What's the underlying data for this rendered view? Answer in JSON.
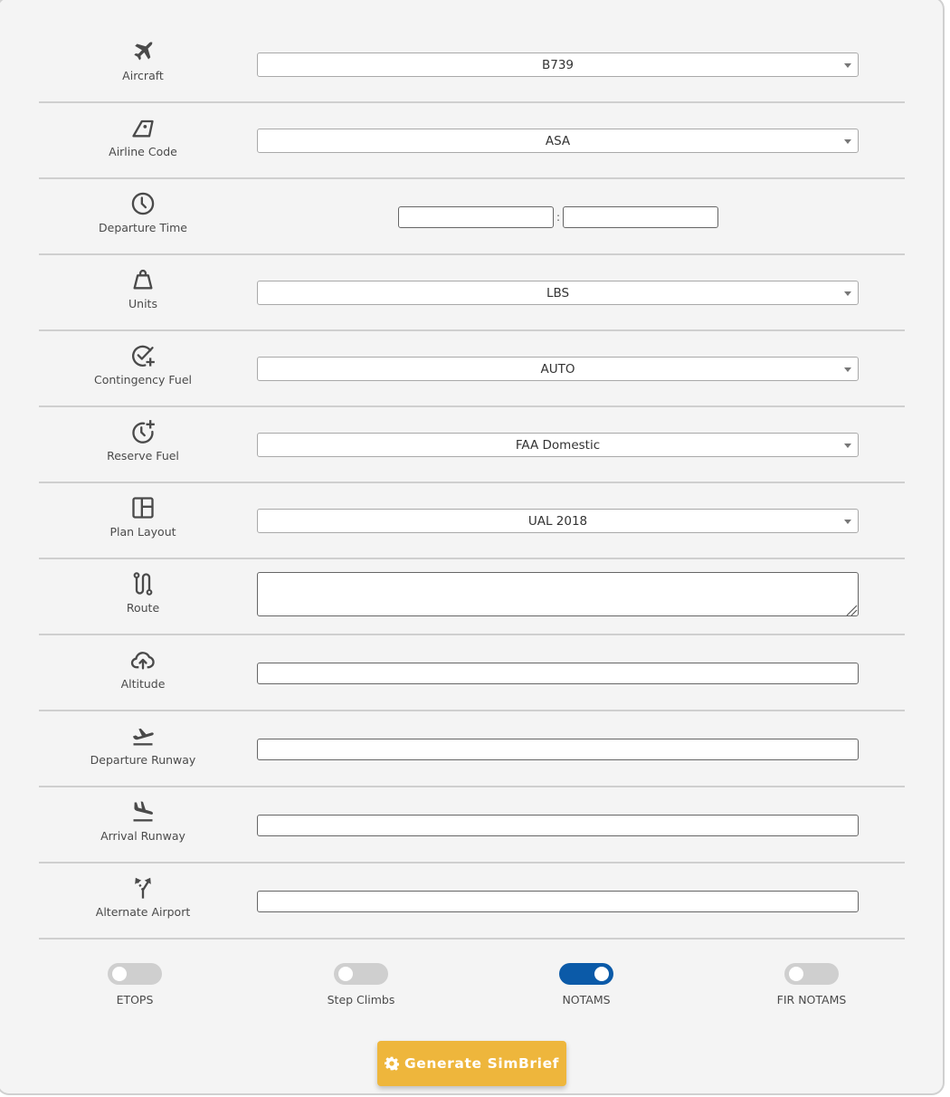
{
  "form": {
    "rows": [
      {
        "id": "aircraft",
        "label": "Aircraft",
        "icon": "airplane-icon",
        "type": "select",
        "value": "B739"
      },
      {
        "id": "airline-code",
        "label": "Airline Code",
        "icon": "tail-fin-icon",
        "type": "select",
        "value": "ASA"
      },
      {
        "id": "departure-time",
        "label": "Departure Time",
        "icon": "clock-icon",
        "type": "time",
        "hours": "",
        "minutes": "",
        "separator": ":"
      },
      {
        "id": "units",
        "label": "Units",
        "icon": "weight-icon",
        "type": "select",
        "value": "LBS"
      },
      {
        "id": "contingency-fuel",
        "label": "Contingency Fuel",
        "icon": "check-circle-plus-icon",
        "type": "select",
        "value": "AUTO"
      },
      {
        "id": "reserve-fuel",
        "label": "Reserve Fuel",
        "icon": "clock-plus-icon",
        "type": "select",
        "value": "FAA Domestic"
      },
      {
        "id": "plan-layout",
        "label": "Plan Layout",
        "icon": "layout-icon",
        "type": "select",
        "value": "UAL 2018"
      },
      {
        "id": "route",
        "label": "Route",
        "icon": "route-icon",
        "type": "textarea",
        "value": ""
      },
      {
        "id": "altitude",
        "label": "Altitude",
        "icon": "cloud-upload-icon",
        "type": "text",
        "value": ""
      },
      {
        "id": "departure-runway",
        "label": "Departure Runway",
        "icon": "takeoff-icon",
        "type": "text",
        "value": ""
      },
      {
        "id": "arrival-runway",
        "label": "Arrival Runway",
        "icon": "landing-icon",
        "type": "text",
        "value": ""
      },
      {
        "id": "alternate-airport",
        "label": "Alternate Airport",
        "icon": "split-arrows-icon",
        "type": "text",
        "value": ""
      }
    ]
  },
  "toggles": [
    {
      "id": "etops",
      "label": "ETOPS",
      "on": false
    },
    {
      "id": "step-climbs",
      "label": "Step Climbs",
      "on": false
    },
    {
      "id": "notams",
      "label": "NOTAMS",
      "on": true
    },
    {
      "id": "fir-notams",
      "label": "FIR NOTAMS",
      "on": false
    }
  ],
  "generate_button": {
    "label": "Generate SimBrief",
    "icon": "gear-icon"
  },
  "colors": {
    "toggle_on": "#0b5aa8",
    "toggle_off": "#cfcfcf",
    "button_accent": "#eeb63c"
  }
}
